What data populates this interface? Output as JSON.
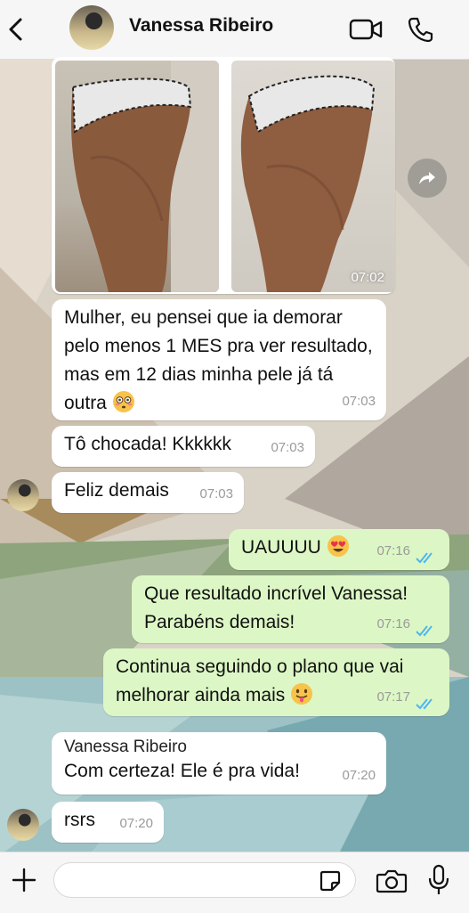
{
  "header": {
    "contact_name": "Vanessa Ribeiro",
    "icons": [
      "back-icon",
      "avatar",
      "video-call-icon",
      "phone-icon"
    ]
  },
  "messages": [
    {
      "type": "image",
      "direction": "in",
      "time": "07:02"
    },
    {
      "type": "text",
      "direction": "in",
      "text": "Mulher, eu pensei que ia demorar pelo menos 1 MES pra ver resultado, mas em 12 dias minha pele já tá outra",
      "emoji": "flushed-face",
      "time": "07:03"
    },
    {
      "type": "text",
      "direction": "in",
      "text": "Tô chocada! Kkkkkk",
      "time": "07:03"
    },
    {
      "type": "text",
      "direction": "in",
      "text": "Feliz demais",
      "time": "07:03"
    },
    {
      "type": "text",
      "direction": "out",
      "text": "UAUUUU",
      "emoji": "heart-eyes-face",
      "time": "07:16",
      "status": "read"
    },
    {
      "type": "text",
      "direction": "out",
      "text": "Que resultado incrível Vanessa! Parabéns demais!",
      "time": "07:16",
      "status": "read"
    },
    {
      "type": "text",
      "direction": "out",
      "text": "Continua seguindo o plano que vai melhorar ainda mais",
      "emoji": "tongue-face",
      "time": "07:17",
      "status": "read"
    },
    {
      "type": "text",
      "direction": "in",
      "sender": "Vanessa Ribeiro",
      "text": "Com certeza! Ele é pra vida!",
      "time": "07:20"
    },
    {
      "type": "text",
      "direction": "in",
      "text": "rsrs",
      "time": "07:20"
    }
  ],
  "input": {
    "value": "",
    "placeholder": ""
  },
  "colors": {
    "incoming": "#ffffff",
    "outgoing": "#dcf7c5",
    "ticks": "#4fb6ec"
  }
}
